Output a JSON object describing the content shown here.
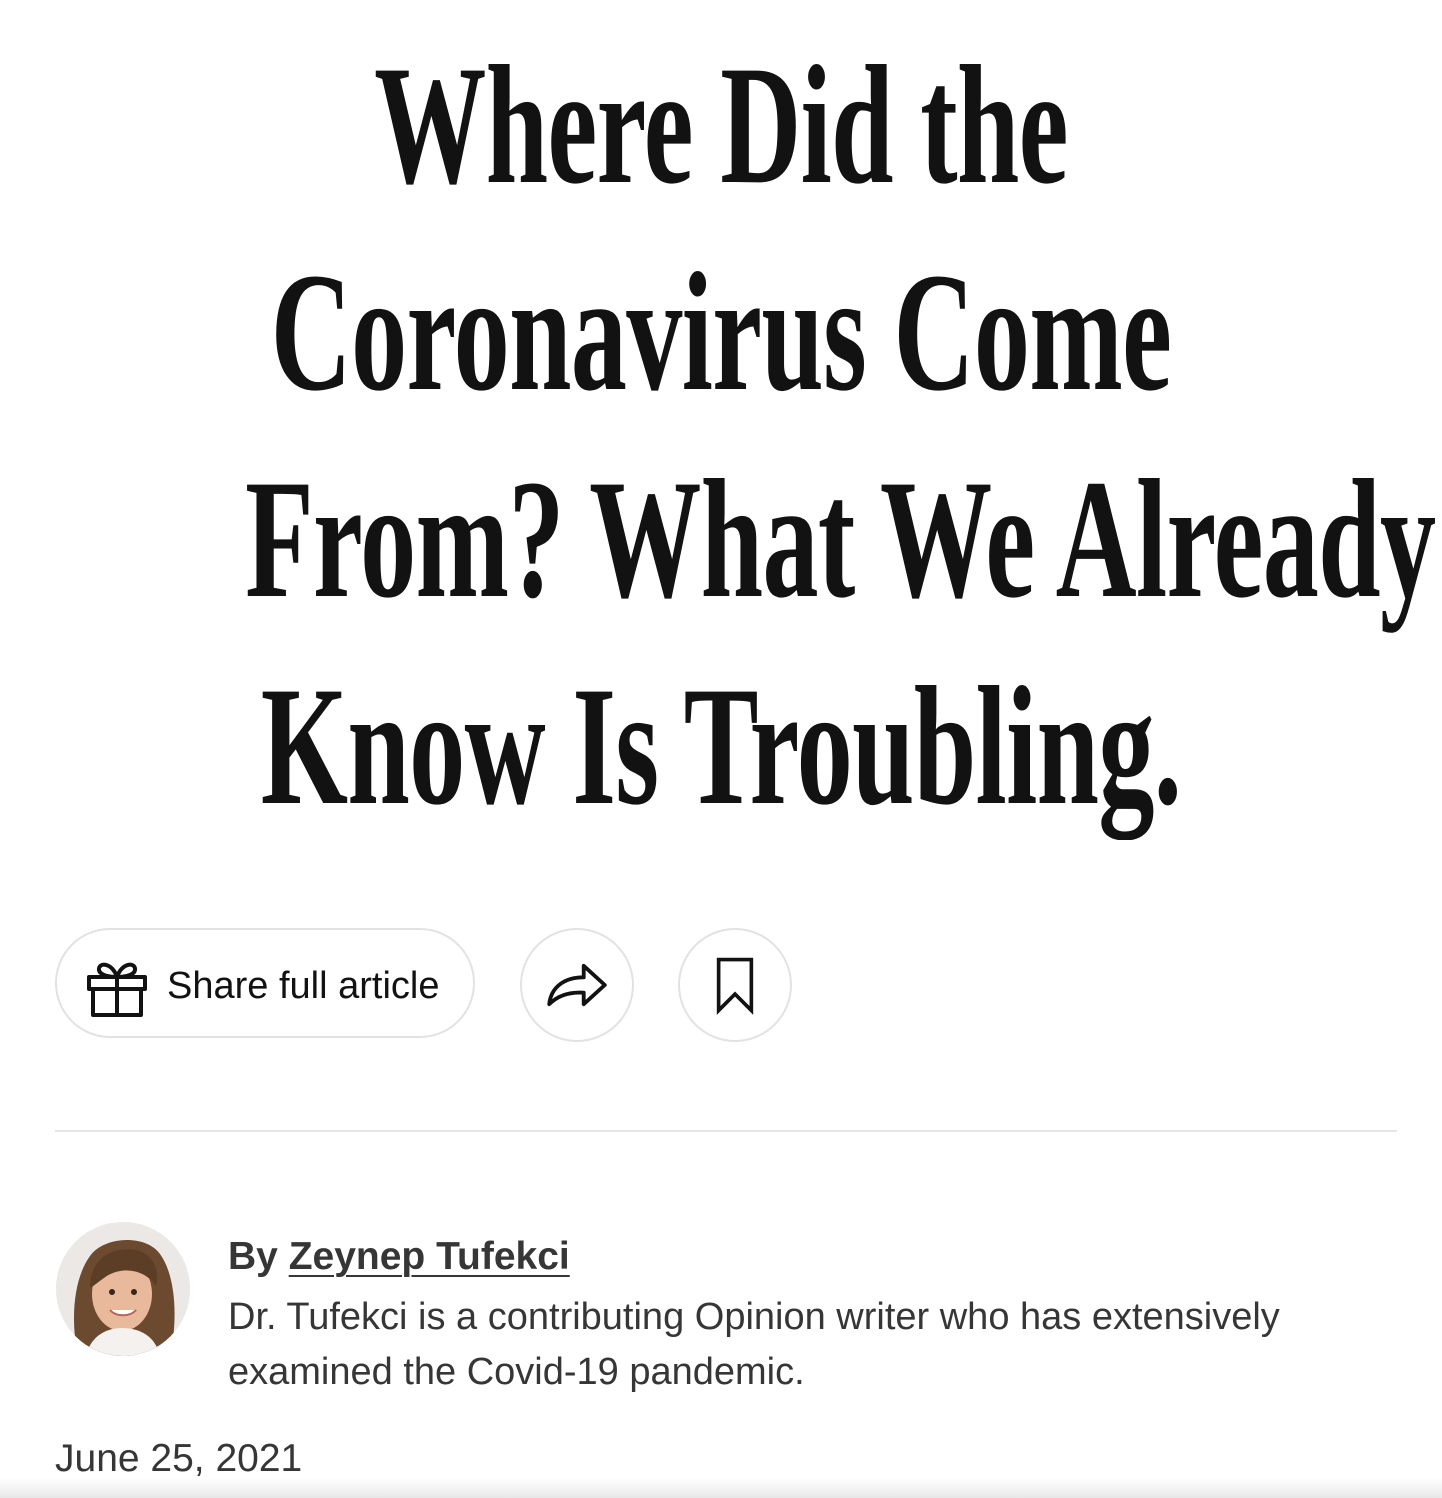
{
  "article": {
    "headline_lines": [
      "Where Did the",
      "Coronavirus Come",
      "From? What We Already",
      "Know Is Troubling."
    ]
  },
  "actions": {
    "share_full_label": "Share full article",
    "gift_icon": "gift-icon",
    "share_icon": "share-arrow-icon",
    "save_icon": "bookmark-icon"
  },
  "byline": {
    "prefix": "By",
    "author": "Zeynep Tufekci",
    "bio": "Dr. Tufekci is a contributing Opinion writer who has extensively examined the Covid-19 pandemic."
  },
  "date": "June 25, 2021",
  "colors": {
    "text": "#121212",
    "secondary_text": "#363636",
    "border": "#e2e2e2"
  }
}
